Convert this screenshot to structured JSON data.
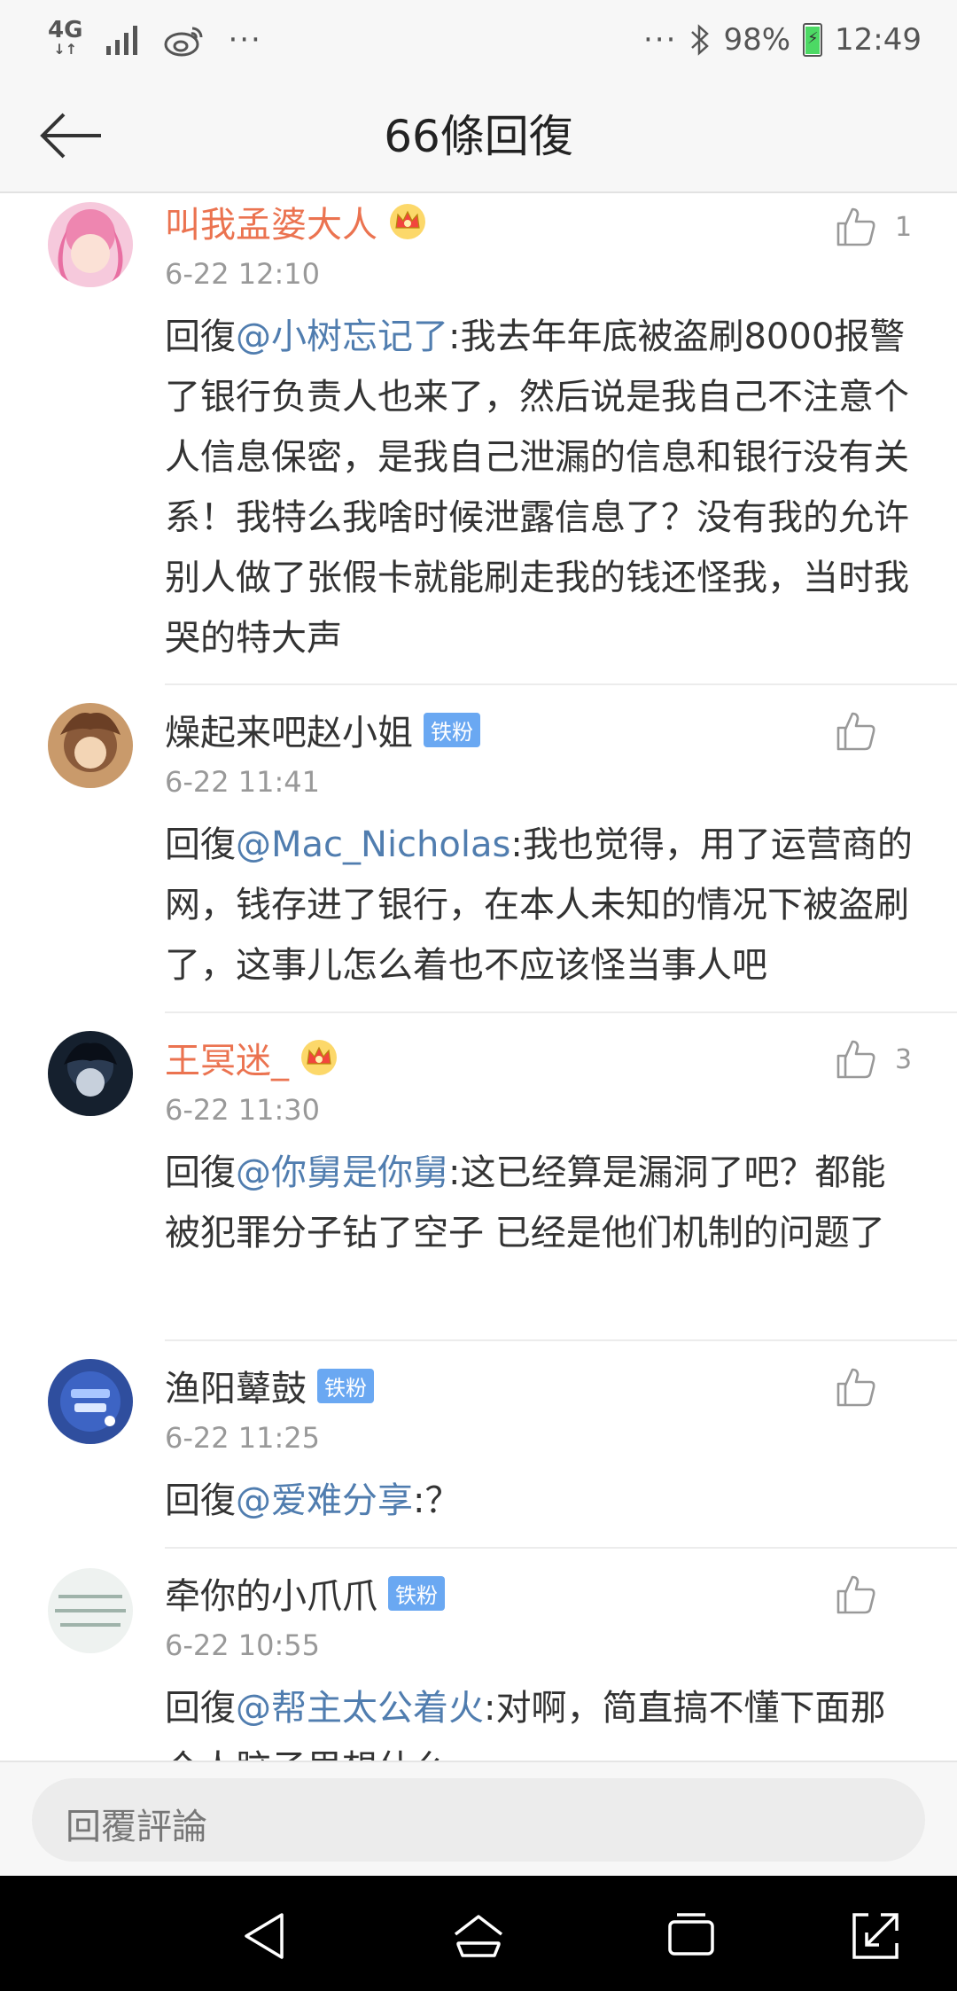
{
  "status_bar": {
    "network": "4G",
    "network_arrows": "↓↑",
    "overflow": "···",
    "overflow_right": "···",
    "battery": "98%",
    "time": "12:49"
  },
  "header": {
    "title": "66條回復"
  },
  "comments": [
    {
      "username": "叫我孟婆大人",
      "vip": true,
      "time": "6-22 12:10",
      "likes": "1",
      "prefix": "回復",
      "mention": "@小树忘记了",
      "body": ":我去年年底被盗刷8000报警了银行负责人也来了，然后说是我自己不注意个人信息保密，是我自己泄漏的信息和银行没有关系！我特么我啥时候泄露信息了？没有我的允许别人做了张假卡就能刷走我的钱还怪我，当时我哭的特大声"
    },
    {
      "username": "燥起来吧赵小姐",
      "badge": "铁粉",
      "time": "6-22 11:41",
      "likes": "",
      "prefix": "回復",
      "mention": "@Mac_Nicholas",
      "body": ":我也觉得，用了运营商的网，钱存进了银行，在本人未知的情况下被盗刷了，这事儿怎么着也不应该怪当事人吧"
    },
    {
      "username": "王冥迷_",
      "vip": true,
      "time": "6-22 11:30",
      "likes": "3",
      "prefix": "回復",
      "mention": "@你舅是你舅",
      "body": ":这已经算是漏洞了吧？都能被犯罪分子钻了空子 已经是他们机制的问题了"
    },
    {
      "username": "渔阳鼙鼓",
      "badge": "铁粉",
      "time": "6-22 11:25",
      "likes": "",
      "prefix": "回復",
      "mention": "@爱难分享",
      "body": ":？"
    },
    {
      "username": "牵你的小爪爪",
      "badge": "铁粉",
      "time": "6-22 10:55",
      "likes": "",
      "prefix": "回復",
      "mention": "@帮主太公着火",
      "body": ":对啊，简直搞不懂下面那个人脑子里想什么"
    }
  ],
  "reply_bar": {
    "placeholder": "回覆評論"
  },
  "colors": {
    "vip_name": "#eb7350",
    "mention": "#507daf",
    "badge": "#6aa8f2",
    "nav_bar": "#000000"
  }
}
